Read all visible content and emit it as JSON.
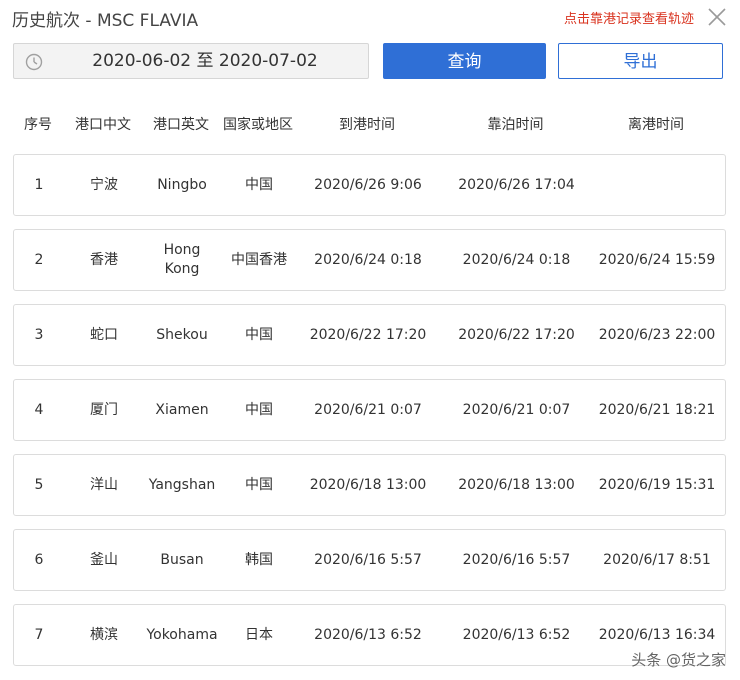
{
  "window": {
    "title": "历史航次 - MSC FLAVIA",
    "track_link": "点击靠港记录查看轨迹"
  },
  "toolbar": {
    "date_range": "2020-06-02 至 2020-07-02",
    "query_label": "查询",
    "export_label": "导出"
  },
  "table": {
    "headers": [
      "序号",
      "港口中文",
      "港口英文",
      "国家或地区",
      "到港时间",
      "靠泊时间",
      "离港时间"
    ],
    "rows": [
      {
        "seq": "1",
        "port_cn": "宁波",
        "port_en": "Ningbo",
        "region": "中国",
        "arrival": "2020/6/26 9:06",
        "berth": "2020/6/26 17:04",
        "departure": ""
      },
      {
        "seq": "2",
        "port_cn": "香港",
        "port_en": "Hong Kong",
        "region": "中国香港",
        "arrival": "2020/6/24 0:18",
        "berth": "2020/6/24 0:18",
        "departure": "2020/6/24 15:59"
      },
      {
        "seq": "3",
        "port_cn": "蛇口",
        "port_en": "Shekou",
        "region": "中国",
        "arrival": "2020/6/22 17:20",
        "berth": "2020/6/22 17:20",
        "departure": "2020/6/23 22:00"
      },
      {
        "seq": "4",
        "port_cn": "厦门",
        "port_en": "Xiamen",
        "region": "中国",
        "arrival": "2020/6/21 0:07",
        "berth": "2020/6/21 0:07",
        "departure": "2020/6/21 18:21"
      },
      {
        "seq": "5",
        "port_cn": "洋山",
        "port_en": "Yangshan",
        "region": "中国",
        "arrival": "2020/6/18 13:00",
        "berth": "2020/6/18 13:00",
        "departure": "2020/6/19 15:31"
      },
      {
        "seq": "6",
        "port_cn": "釜山",
        "port_en": "Busan",
        "region": "韩国",
        "arrival": "2020/6/16 5:57",
        "berth": "2020/6/16 5:57",
        "departure": "2020/6/17 8:51"
      },
      {
        "seq": "7",
        "port_cn": "横滨",
        "port_en": "Yokohama",
        "region": "日本",
        "arrival": "2020/6/13 6:52",
        "berth": "2020/6/13 6:52",
        "departure": "2020/6/13 16:34"
      }
    ]
  },
  "watermark": "头条 @货之家",
  "icons": {
    "date": "clock-icon",
    "close": "close-icon"
  },
  "colors": {
    "accent": "#2f6fd6",
    "link": "#d9331f",
    "border": "#dcdcdc"
  }
}
